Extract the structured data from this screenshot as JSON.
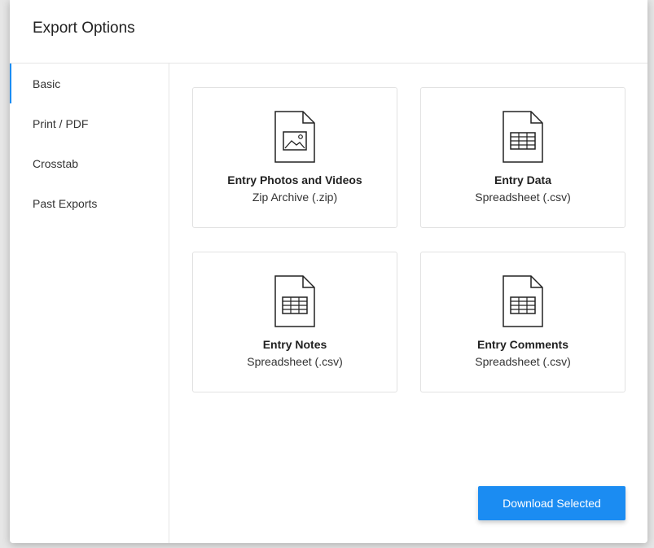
{
  "modal": {
    "title": "Export Options"
  },
  "sidebar": {
    "items": [
      {
        "label": "Basic",
        "active": true
      },
      {
        "label": "Print / PDF",
        "active": false
      },
      {
        "label": "Crosstab",
        "active": false
      },
      {
        "label": "Past Exports",
        "active": false
      }
    ]
  },
  "cards": [
    {
      "title": "Entry Photos and Videos",
      "subtitle": "Zip Archive (.zip)",
      "icon": "image-file-icon"
    },
    {
      "title": "Entry Data",
      "subtitle": "Spreadsheet (.csv)",
      "icon": "spreadsheet-file-icon"
    },
    {
      "title": "Entry Notes",
      "subtitle": "Spreadsheet (.csv)",
      "icon": "spreadsheet-file-icon"
    },
    {
      "title": "Entry Comments",
      "subtitle": "Spreadsheet (.csv)",
      "icon": "spreadsheet-file-icon"
    }
  ],
  "actions": {
    "download_label": "Download Selected"
  },
  "colors": {
    "accent": "#1b8cf2"
  }
}
